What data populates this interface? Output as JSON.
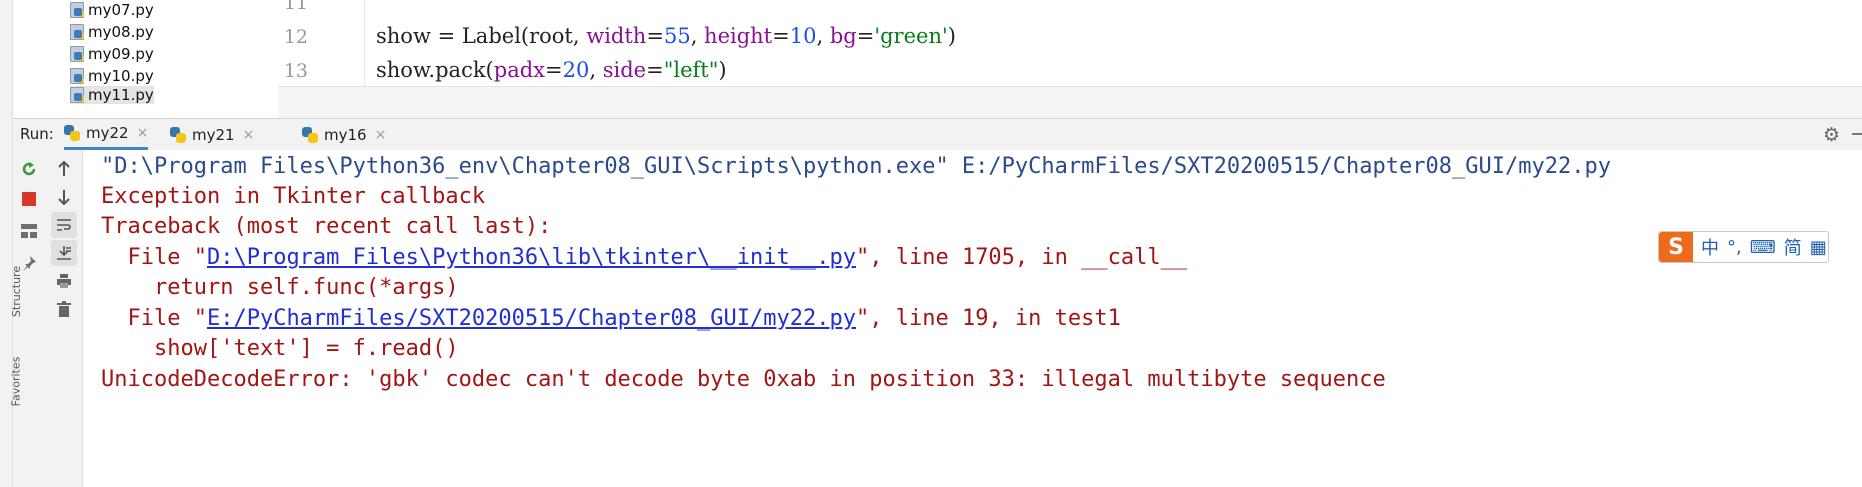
{
  "project_tree": {
    "files": [
      "my07.py",
      "my08.py",
      "my09.py",
      "my10.py",
      "my11.py"
    ]
  },
  "editor": {
    "line_numbers": [
      "11",
      "12",
      "13"
    ],
    "code": {
      "line12": {
        "a": "show = Label(root, ",
        "b": "width",
        "c": "=",
        "d": "55",
        "e": ", ",
        "f": "height",
        "g": "=",
        "h": "10",
        "i": ", ",
        "j": "bg",
        "k": "=",
        "l": "'green'",
        "m": ")"
      },
      "line13": {
        "a": "show.pack(",
        "b": "padx",
        "c": "=",
        "d": "20",
        "e": ", ",
        "f": "side",
        "g": "=",
        "h": "\"left\"",
        "i": ")"
      }
    }
  },
  "run": {
    "label": "Run:",
    "tabs": [
      "my22",
      "my21",
      "my16"
    ],
    "active_tab": "my22",
    "close_glyph": "×"
  },
  "console": {
    "command": "\"D:\\Program Files\\Python36_env\\Chapter08_GUI\\Scripts\\python.exe\" E:/PyCharmFiles/SXT20200515/Chapter08_GUI/my22.py",
    "exception": "Exception in Tkinter callback",
    "traceback": "Traceback (most recent call last):",
    "frame1_prefix": "  File \"",
    "frame1_link": "D:\\Program Files\\Python36\\lib\\tkinter\\__init__.py",
    "frame1_suffix": "\", line 1705, in __call__",
    "frame1_code": "    return self.func(*args)",
    "frame2_prefix": "  File \"",
    "frame2_link": "E:/PyCharmFiles/SXT20200515/Chapter08_GUI/my22.py",
    "frame2_suffix": "\", line 19, in test1",
    "frame2_code": "    show['text'] = f.read()",
    "error": "UnicodeDecodeError: 'gbk' codec can't decode byte 0xab in position 33: illegal multibyte sequence"
  },
  "ime": {
    "logo": "S",
    "items": [
      "中",
      "°,",
      "⌨",
      "简",
      "▦"
    ]
  },
  "side_labels": [
    "Structure",
    "Favorites"
  ],
  "colors": {
    "error_text": "#a31515",
    "command_text": "#2b4a8c",
    "link": "#1f2fd1",
    "rerun": "#3a9a3a",
    "stop": "#d9362b"
  }
}
